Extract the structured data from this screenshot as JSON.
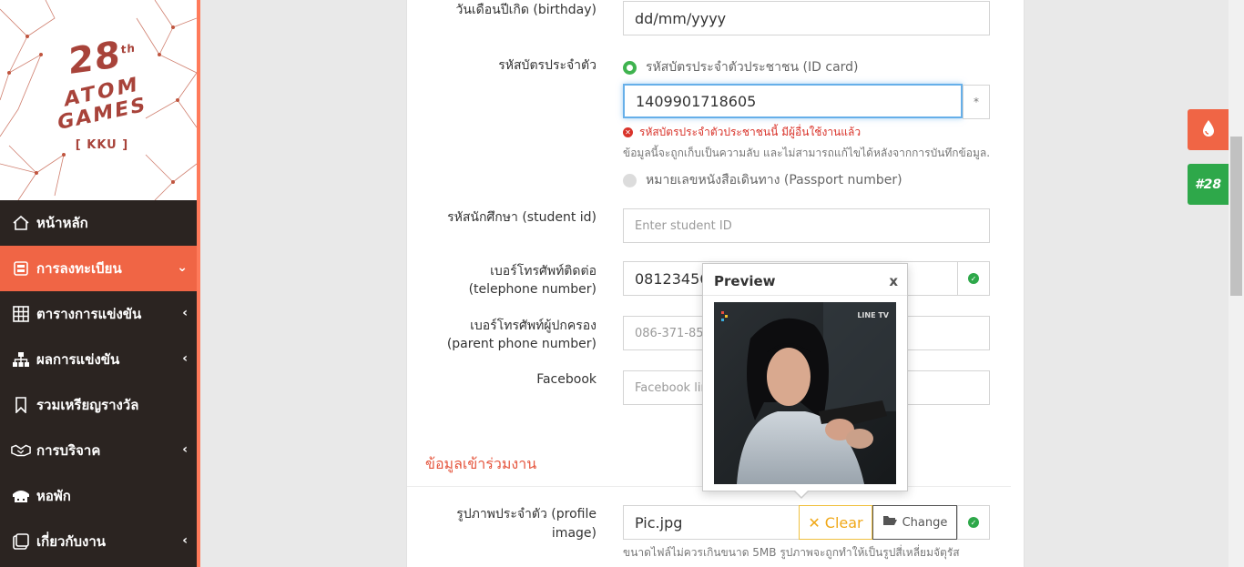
{
  "logo": {
    "number": "28",
    "suffix": "th",
    "line1": "ATOM",
    "line2": "GAMES",
    "tag": "[ KKU ]"
  },
  "sidebar": {
    "items": [
      {
        "label": "หน้าหลัก",
        "icon": "home-icon"
      },
      {
        "label": "การลงทะเบียน",
        "icon": "register-icon",
        "active": true
      },
      {
        "label": "ตารางการแข่งขัน",
        "icon": "grid-icon"
      },
      {
        "label": "ผลการแข่งขัน",
        "icon": "sitemap-icon"
      },
      {
        "label": "รวมเหรียญรางวัล",
        "icon": "bookmark-icon"
      },
      {
        "label": "การบริจาค",
        "icon": "handshake-icon"
      },
      {
        "label": "หอพัก",
        "icon": "building-icon"
      },
      {
        "label": "เกี่ยวกับงาน",
        "icon": "info-icon"
      }
    ]
  },
  "form": {
    "birthday_label": "วันเดือนปีเกิด (birthday)",
    "birthday_value": "dd/mm/yyyy",
    "idcard_label": "รหัสบัตรประจำตัว",
    "radio_idcard": "รหัสบัตรประจำตัวประชาชน (ID card)",
    "idcard_value": "1409901718605",
    "idcard_addon": "*",
    "idcard_error": "รหัสบัตรประจำตัวประชาชนนี้ มีผู้อื่นใช้งานแล้ว",
    "idcard_help": "ข้อมูลนี้จะถูกเก็บเป็นความลับ และไม่สามารถแก้ไขได้หลังจากการบันทึกข้อมูล.",
    "radio_passport": "หมายเลขหนังสือเดินทาง (Passport number)",
    "student_label": "รหัสนักศึกษา (student id)",
    "student_placeholder": "Enter student ID",
    "phone_label_1": "เบอร์โทรศัพท์ติดต่อ",
    "phone_label_2": "(telephone number)",
    "phone_value": "081234567",
    "parent_label_1": "เบอร์โทรศัพท์ผู้ปกครอง",
    "parent_label_2": "(parent phone number)",
    "parent_placeholder": "086-371-8555",
    "facebook_label": "Facebook",
    "facebook_placeholder": "Facebook link",
    "section_title": "ข้อมูลเข้าร่วมงาน",
    "profile_label_1": "รูปภาพประจำตัว (profile",
    "profile_label_2": "image)",
    "profile_file": "Pic.jpg",
    "clear_label": "Clear",
    "change_label": "Change",
    "profile_help": "ขนาดไฟล์ไม่ควรเกินขนาด 5MB รูปภาพจะถูกทำให้เป็นรูปสี่เหลี่ยมจัตุรัส"
  },
  "preview": {
    "title": "Preview",
    "close": "x",
    "watermark": "LINE TV"
  },
  "floating": {
    "green_label": "#28"
  },
  "colors": {
    "accent": "#f06545",
    "sidebar_bg": "#2b2421",
    "success": "#2ea84a",
    "error": "#d9332a",
    "section": "#e5553d"
  }
}
